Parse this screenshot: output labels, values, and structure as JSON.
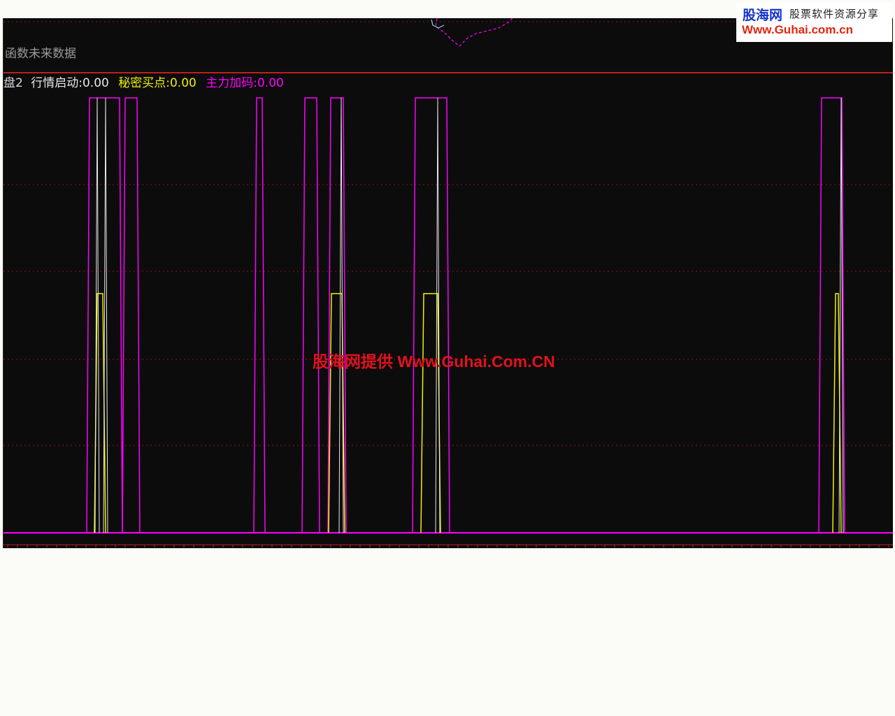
{
  "top_panel": {
    "hint_text": "函数未来数据"
  },
  "indicator_header": {
    "name": "盘2",
    "items": [
      {
        "label": "行情启动",
        "value": "0.00",
        "color": "#e8e8e8"
      },
      {
        "label": "秘密买点",
        "value": "0.00",
        "color": "#f0f000"
      },
      {
        "label": "主力加码",
        "value": "0.00",
        "color": "#ff00ff"
      }
    ]
  },
  "watermark": {
    "logo": "股海网",
    "tagline": "股票软件资源分享",
    "url": "Www.Guhai.com.cn",
    "center_text": "股海网提供 Www.Guhai.Com.CN"
  },
  "colors": {
    "background": "#0c0c0c",
    "grid": "#8b1414",
    "divider": "#c41e1e",
    "white_series": "#e8e8e8",
    "yellow_series": "#f0f000",
    "magenta_series": "#ff00ff"
  },
  "chart_data": {
    "type": "line",
    "ylim": [
      0,
      100
    ],
    "grid": true,
    "series": [
      {
        "name": "行情启动",
        "color": "#e8e8e8",
        "spikes": [
          {
            "x": 134,
            "y": 100
          },
          {
            "x": 146,
            "y": 100
          },
          {
            "x": 483,
            "y": 100
          },
          {
            "x": 621,
            "y": 100
          },
          {
            "x": 1198,
            "y": 100
          }
        ]
      },
      {
        "name": "秘密买点",
        "color": "#f0f000",
        "pulses": [
          {
            "x0": 130,
            "x1": 146,
            "y": 55
          },
          {
            "x0": 465,
            "x1": 488,
            "y": 55
          },
          {
            "x0": 597,
            "x1": 625,
            "y": 55
          },
          {
            "x0": 1186,
            "x1": 1198,
            "y": 55
          }
        ]
      },
      {
        "name": "主力加码",
        "color": "#ff00ff",
        "pulses": [
          {
            "x0": 119,
            "x1": 170,
            "y": 100
          },
          {
            "x0": 170,
            "x1": 195,
            "y": 100
          },
          {
            "x0": 358,
            "x1": 374,
            "y": 100
          },
          {
            "x0": 427,
            "x1": 452,
            "y": 100
          },
          {
            "x0": 464,
            "x1": 490,
            "y": 100
          },
          {
            "x0": 585,
            "x1": 638,
            "y": 100
          },
          {
            "x0": 1166,
            "x1": 1203,
            "y": 100
          }
        ]
      }
    ]
  }
}
